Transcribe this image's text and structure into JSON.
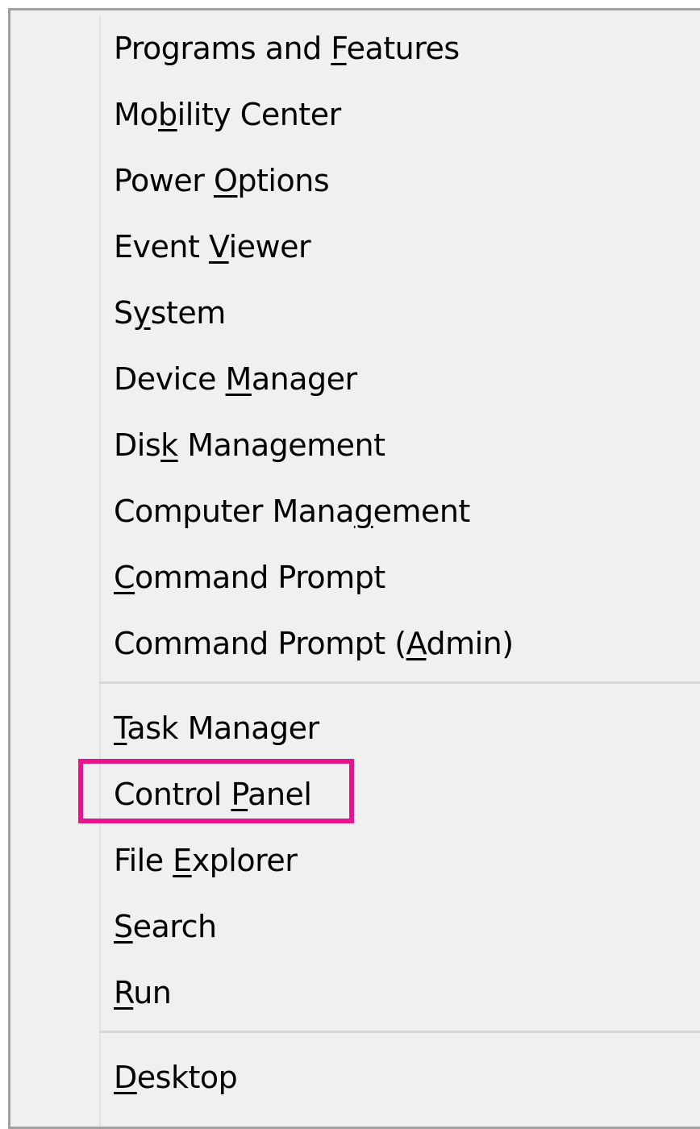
{
  "menu": {
    "groups": [
      [
        {
          "pre": "Programs and ",
          "key": "F",
          "post": "eatures"
        },
        {
          "pre": "Mo",
          "key": "b",
          "post": "ility Center"
        },
        {
          "pre": "Power ",
          "key": "O",
          "post": "ptions"
        },
        {
          "pre": "Event ",
          "key": "V",
          "post": "iewer"
        },
        {
          "pre": "S",
          "key": "y",
          "post": "stem"
        },
        {
          "pre": "Device ",
          "key": "M",
          "post": "anager"
        },
        {
          "pre": "Dis",
          "key": "k",
          "post": " Management"
        },
        {
          "pre": "Computer Mana",
          "key": "g",
          "post": "ement"
        },
        {
          "pre": "",
          "key": "C",
          "post": "ommand Prompt"
        },
        {
          "pre": "Command Prompt (",
          "key": "A",
          "post": "dmin)"
        }
      ],
      [
        {
          "pre": "",
          "key": "T",
          "post": "ask Manager"
        },
        {
          "pre": "Control ",
          "key": "P",
          "post": "anel"
        },
        {
          "pre": "File ",
          "key": "E",
          "post": "xplorer"
        },
        {
          "pre": "",
          "key": "S",
          "post": "earch"
        },
        {
          "pre": "",
          "key": "R",
          "post": "un"
        }
      ],
      [
        {
          "pre": "",
          "key": "D",
          "post": "esktop"
        }
      ]
    ],
    "highlighted_item": "Control Panel",
    "highlight_color": "#e6158c"
  }
}
